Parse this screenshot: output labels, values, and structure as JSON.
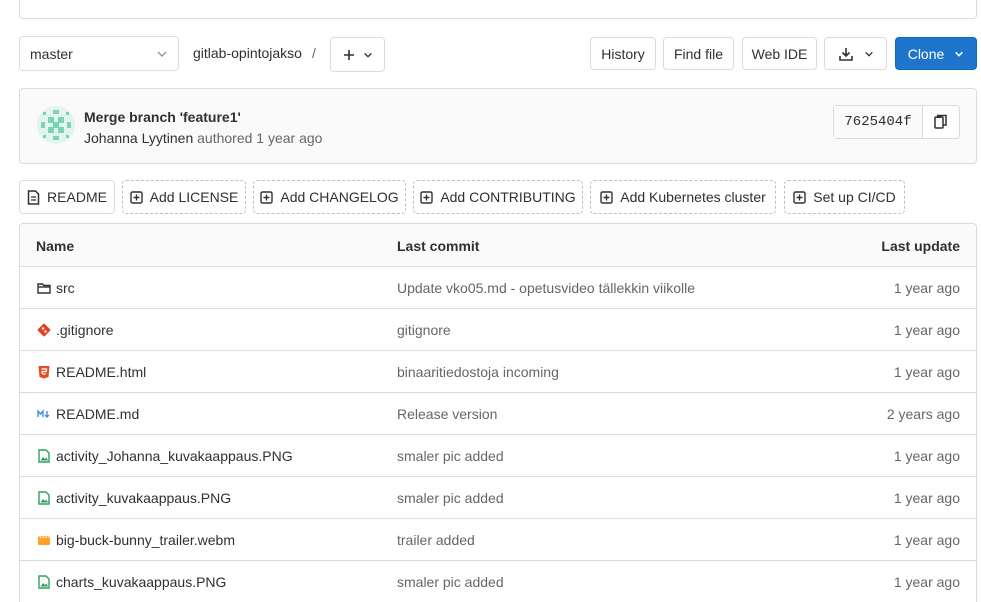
{
  "toolbar": {
    "branch": "master",
    "project": "gitlab-opintojakso",
    "path_separator": "/",
    "history_label": "History",
    "find_file_label": "Find file",
    "web_ide_label": "Web IDE",
    "clone_label": "Clone"
  },
  "commit": {
    "title": "Merge branch 'feature1'",
    "author": "Johanna Lyytinen",
    "authored_text": "authored 1 year ago",
    "sha": "7625404f"
  },
  "quick_actions": [
    {
      "label": "README",
      "icon": "file-icon"
    },
    {
      "label": "Add LICENSE",
      "icon": "plus-square-icon"
    },
    {
      "label": "Add CHANGELOG",
      "icon": "plus-square-icon"
    },
    {
      "label": "Add CONTRIBUTING",
      "icon": "plus-square-icon"
    },
    {
      "label": "Add Kubernetes cluster",
      "icon": "plus-square-icon"
    },
    {
      "label": "Set up CI/CD",
      "icon": "plus-square-icon"
    }
  ],
  "table": {
    "headers": {
      "name": "Name",
      "last_commit": "Last commit",
      "last_update": "Last update"
    },
    "rows": [
      {
        "name": "src",
        "icon": "folder-icon",
        "commit": "Update vko05.md - opetusvideo tällekkin viikolle",
        "updated": "1 year ago"
      },
      {
        "name": ".gitignore",
        "icon": "git-icon",
        "commit": "gitignore",
        "updated": "1 year ago"
      },
      {
        "name": "README.html",
        "icon": "html5-icon",
        "commit": "binaaritiedostoja incoming",
        "updated": "1 year ago"
      },
      {
        "name": "README.md",
        "icon": "markdown-icon",
        "commit": "Release version",
        "updated": "2 years ago"
      },
      {
        "name": "activity_Johanna_kuvakaappaus.PNG",
        "icon": "image-icon",
        "commit": "smaler pic added",
        "updated": "1 year ago"
      },
      {
        "name": "activity_kuvakaappaus.PNG",
        "icon": "image-icon",
        "commit": "smaler pic added",
        "updated": "1 year ago"
      },
      {
        "name": "big-buck-bunny_trailer.webm",
        "icon": "video-icon",
        "commit": "trailer added",
        "updated": "1 year ago"
      },
      {
        "name": "charts_kuvakaappaus.PNG",
        "icon": "image-icon",
        "commit": "smaler pic added",
        "updated": "1 year ago"
      }
    ]
  },
  "colors": {
    "primary": "#1f75cb",
    "git": "#e24329",
    "html5": "#e44d26",
    "markdown": "#428fdc",
    "image": "#2da160",
    "video": "#fca326"
  }
}
